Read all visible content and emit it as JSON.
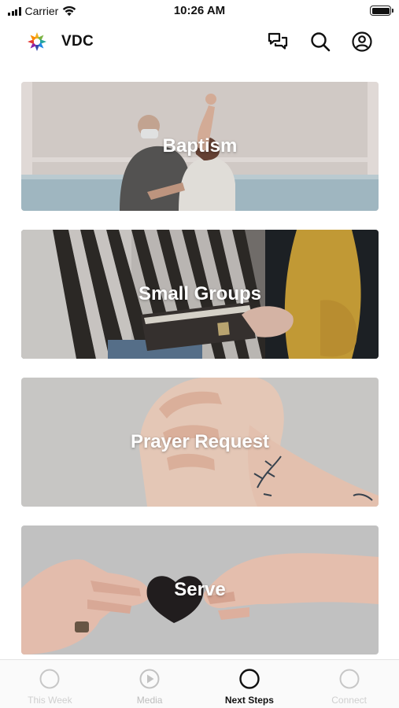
{
  "status_bar": {
    "carrier": "Carrier",
    "time": "10:26 AM"
  },
  "header": {
    "title": "VDC",
    "icons": [
      "logo-icon",
      "chat-icon",
      "search-icon",
      "profile-icon"
    ]
  },
  "cards": [
    {
      "label": "Baptism"
    },
    {
      "label": "Small Groups"
    },
    {
      "label": "Prayer Request"
    },
    {
      "label": "Serve"
    }
  ],
  "tabs": [
    {
      "label": "This Week",
      "icon": "circle-icon",
      "active": false
    },
    {
      "label": "Media",
      "icon": "play-icon",
      "active": false
    },
    {
      "label": "Next Steps",
      "icon": "circle-icon",
      "active": true
    },
    {
      "label": "Connect",
      "icon": "circle-icon",
      "active": false
    }
  ],
  "colors": {
    "active_tab": "#111111",
    "inactive_tab": "#bdbdbd",
    "background": "#ffffff"
  }
}
